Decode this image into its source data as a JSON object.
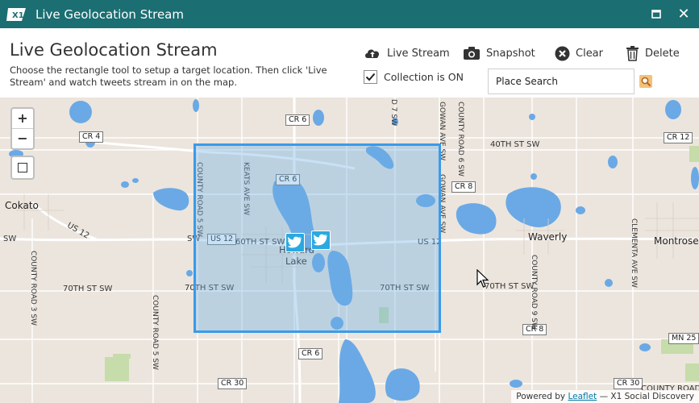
{
  "window": {
    "title": "Live Geolocation Stream"
  },
  "header": {
    "heading": "Live Geolocation Stream",
    "description": "Choose the rectangle tool to setup a target location. Then click 'Live Stream' and watch tweets stream in on the map."
  },
  "toolbar": {
    "live_stream": "Live Stream",
    "snapshot": "Snapshot",
    "clear": "Clear",
    "delete": "Delete",
    "collection": "Collection is ON",
    "collection_checked": true,
    "search_placeholder": "Place Search"
  },
  "map": {
    "zoom_in": "+",
    "zoom_out": "−",
    "labels": {
      "cr6_top": "CR 6",
      "cr6_mid": "CR 6",
      "cr6_bottom": "CR 6",
      "cr4": "CR 4",
      "cr8_right": "CR 8",
      "cr8_bottom": "CR 8",
      "cr12": "CR 12",
      "cr30_left": "CR 30",
      "cr30_right": "CR 30",
      "us12_mid": "US 12",
      "us12_right": "US 12",
      "us12_left": "US 12",
      "mn25": "MN 25",
      "cokato": "Cokato",
      "waverly": "Waverly",
      "montrose": "Montrose",
      "howard": "Howard",
      "lake": "Lake",
      "street_40th": "40TH ST SW",
      "street_60th": "60TH ST SW",
      "street_70th_left": "70TH ST SW",
      "street_70th_mid": "70TH ST SW",
      "street_70th_right": "70TH ST SW",
      "street_70th_far": "70TH ST SW",
      "sw_left": "SW",
      "sw_right": "SW",
      "county_road_5": "COUNTY ROAD 5 SW",
      "keats": "KEATS AVE SW",
      "gowan_top": "GOWAN AVE SW",
      "gowan_mid": "GOWAN AVE SW",
      "county_road_6": "COUNTY ROAD 6 SW",
      "county_road_3": "COUNTY ROAD 3 SW",
      "county_road_5_lower": "COUNTY ROAD 5 SW",
      "county_road_9": "COUNTY ROAD 9 SW",
      "clementa": "CLEMENTA AVE SW",
      "county_road_sw": "COUNTY ROAD SW",
      "d7": "D 7 SW"
    },
    "attribution_prefix": "Powered by",
    "attribution_link": "Leaflet",
    "attribution_suffix": "— X1 Social Discovery"
  },
  "colors": {
    "title_bar": "#1b6e72",
    "water": "#6aa9e6",
    "selection": "#3a9be9",
    "tweet": "#2aa9e0"
  }
}
